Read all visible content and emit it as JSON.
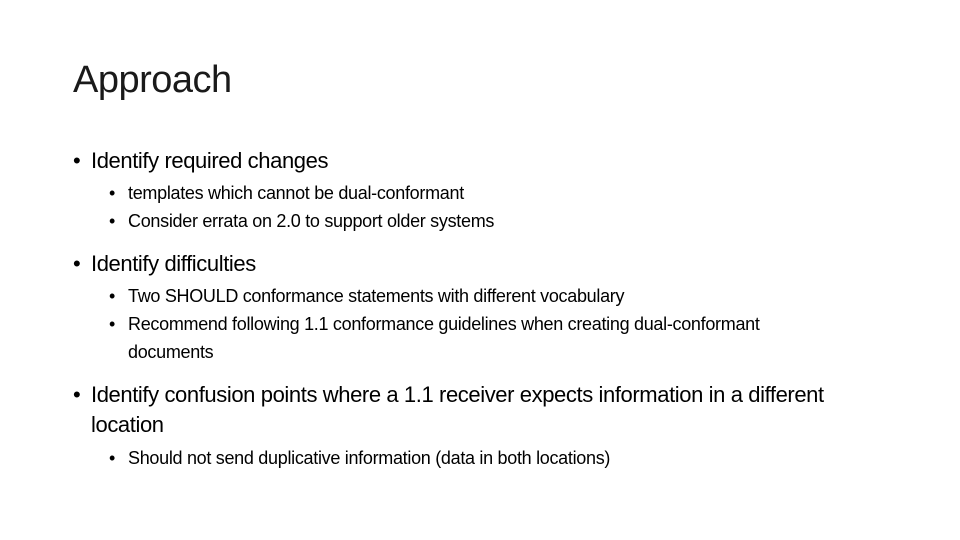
{
  "slide": {
    "title": "Approach",
    "bullet_glyph": "•",
    "sections": [
      {
        "heading": "Identify required changes",
        "items": [
          "templates which cannot be dual-conformant",
          "Consider errata on 2.0 to support older systems"
        ]
      },
      {
        "heading": "Identify difficulties",
        "items": [
          "Two SHOULD conformance statements with different vocabulary",
          "Recommend following 1.1 conformance guidelines when creating dual-conformant documents"
        ]
      },
      {
        "heading": "Identify confusion points where a 1.1 receiver expects information in a different location",
        "items": [
          "Should not send duplicative information (data in both locations)"
        ]
      }
    ]
  }
}
